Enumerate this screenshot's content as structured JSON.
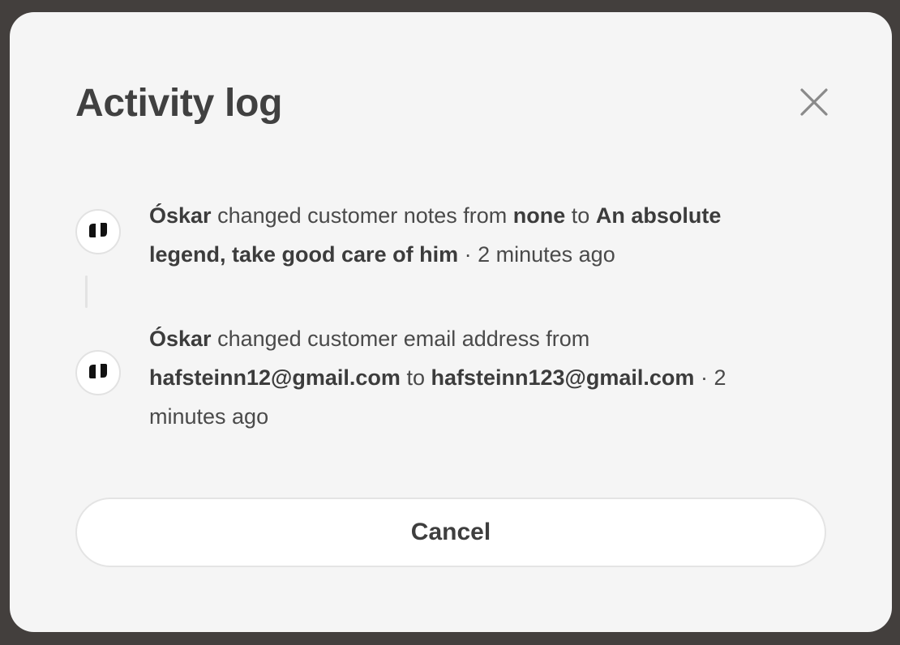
{
  "dialog": {
    "title": "Activity log",
    "close_icon": "close-icon",
    "cancel_label": "Cancel"
  },
  "entries": [
    {
      "avatar_icon": "brand-logo-icon",
      "actor": "Óskar",
      "action": "changed customer notes from",
      "from_value": "none",
      "connector": "to",
      "to_value": "An absolute legend, take good care of him",
      "separator": "·",
      "timestamp": "2 minutes ago"
    },
    {
      "avatar_icon": "brand-logo-icon",
      "actor": "Óskar",
      "action": "changed customer email address from",
      "from_value": "hafsteinn12@gmail.com",
      "connector": "to",
      "to_value": "hafsteinn123@gmail.com",
      "separator": "·",
      "timestamp": "2 minutes ago"
    }
  ],
  "colors": {
    "backdrop": "#433f3d",
    "modal_bg": "#f5f5f5",
    "text": "#3a3a3a",
    "button_bg": "#ffffff"
  }
}
